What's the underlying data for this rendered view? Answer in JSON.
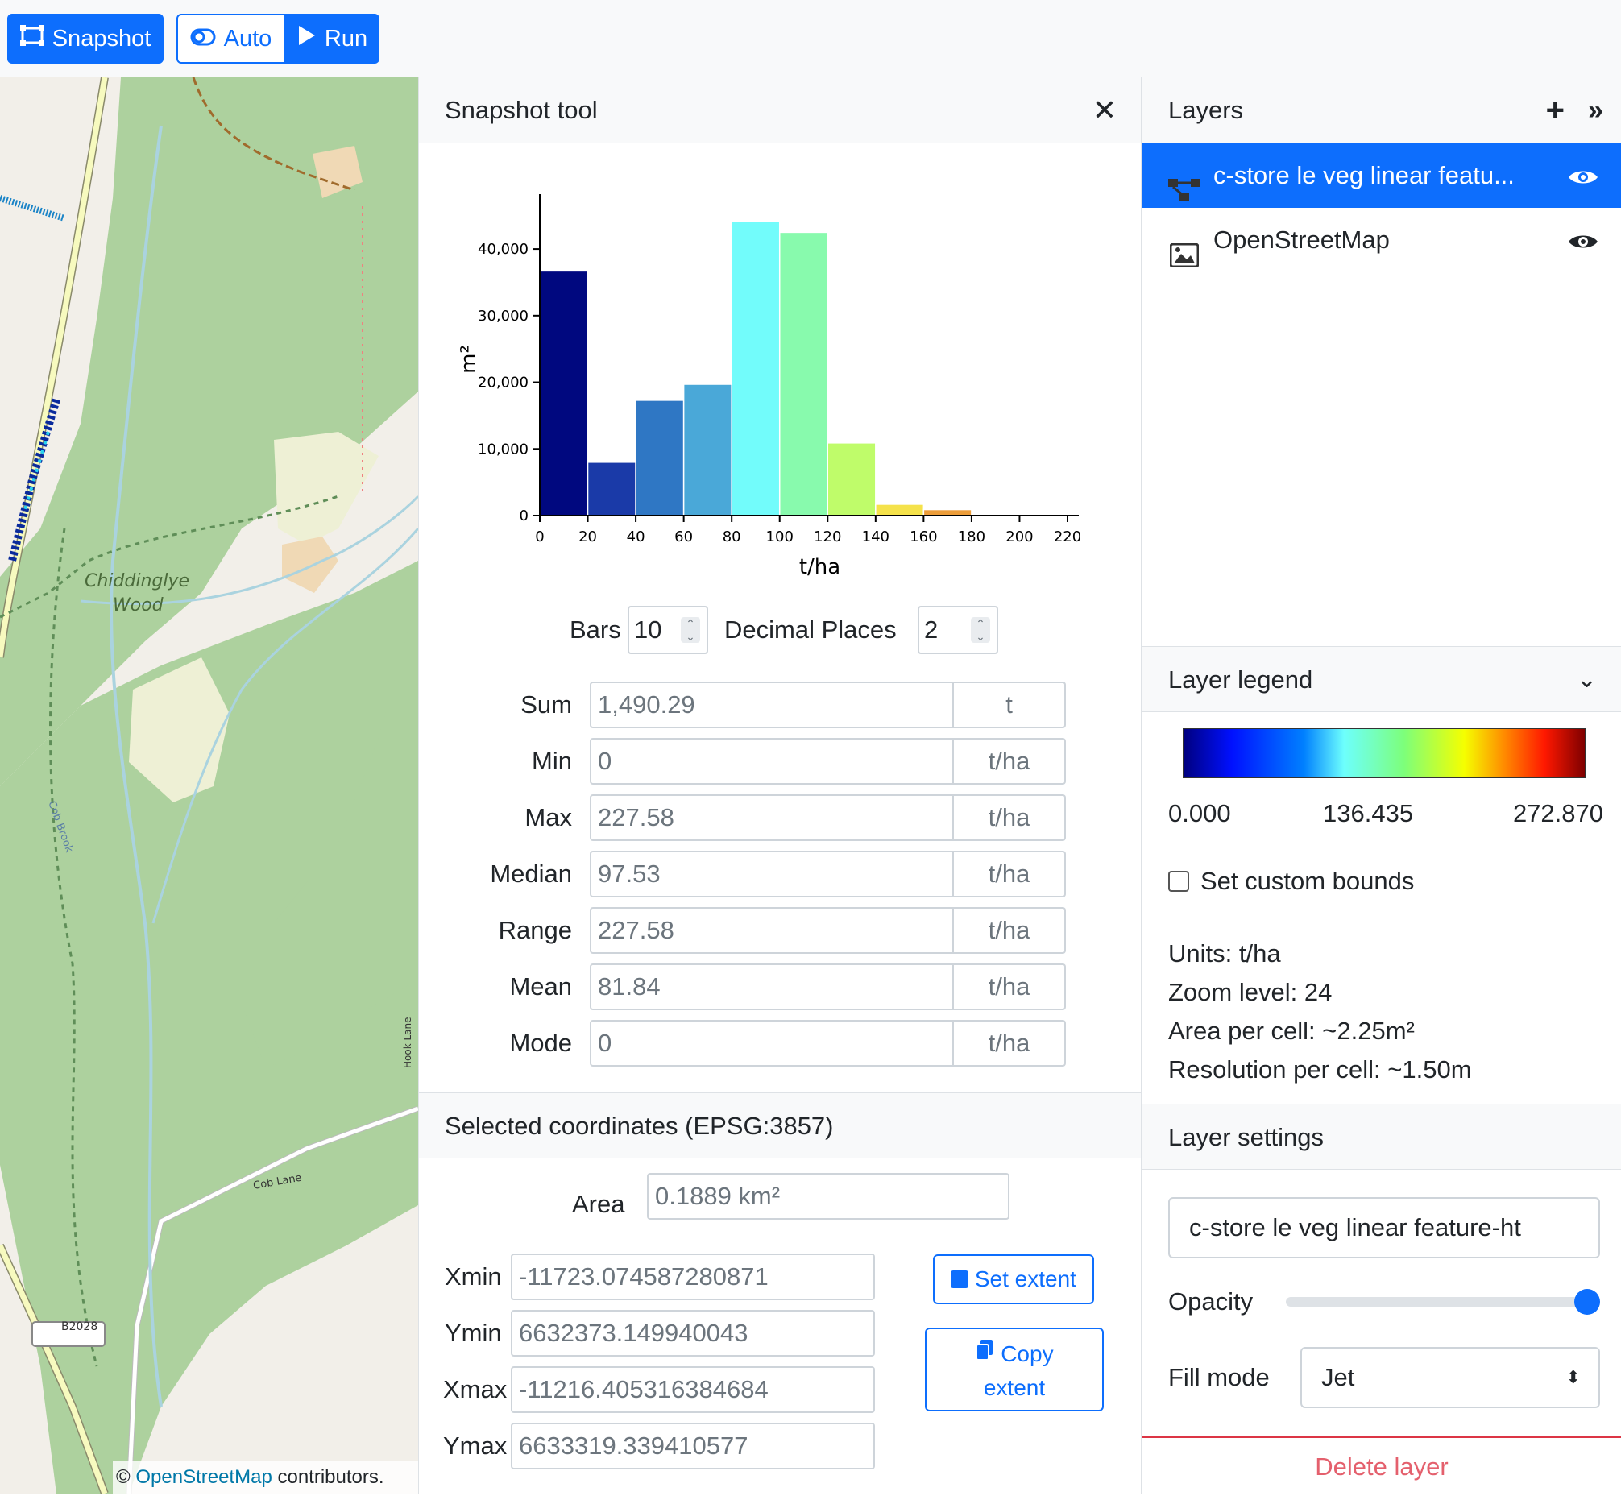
{
  "toolbar": {
    "snapshot_label": "Snapshot",
    "auto_label": "Auto",
    "run_label": "Run"
  },
  "map": {
    "place_label_1": "Chiddinglye",
    "place_label_2": "Wood",
    "road_labels": [
      "Cob Brook",
      "Cob Lane",
      "Hook Lane",
      "B2028",
      "Cob Lane"
    ],
    "attribution_prefix": "©",
    "attribution_link": "OpenStreetMap",
    "attribution_suffix": "contributors."
  },
  "snapshot": {
    "title": "Snapshot tool",
    "bars_label": "Bars",
    "bars_value": "10",
    "decimals_label": "Decimal Places",
    "decimals_value": "2",
    "stats": [
      {
        "label": "Sum",
        "value": "1,490.29",
        "unit": "t"
      },
      {
        "label": "Min",
        "value": "0",
        "unit": "t/ha"
      },
      {
        "label": "Max",
        "value": "227.58",
        "unit": "t/ha"
      },
      {
        "label": "Median",
        "value": "97.53",
        "unit": "t/ha"
      },
      {
        "label": "Range",
        "value": "227.58",
        "unit": "t/ha"
      },
      {
        "label": "Mean",
        "value": "81.84",
        "unit": "t/ha"
      },
      {
        "label": "Mode",
        "value": "0",
        "unit": "t/ha"
      }
    ],
    "coords_title": "Selected coordinates (EPSG:3857)",
    "area_label": "Area",
    "area_value": "0.1889 km²",
    "xmin_label": "Xmin",
    "xmin_value": "-11723.074587280871",
    "ymin_label": "Ymin",
    "ymin_value": "6632373.149940043",
    "xmax_label": "Xmax",
    "xmax_value": "-11216.405316384684",
    "ymax_label": "Ymax",
    "ymax_value": "6633319.339410577",
    "set_extent_label": "Set extent",
    "copy_extent_label_1": "Copy",
    "copy_extent_label_2": "extent"
  },
  "chart_data": {
    "type": "bar",
    "bins": [
      [
        0,
        20
      ],
      [
        20,
        40
      ],
      [
        40,
        60
      ],
      [
        60,
        80
      ],
      [
        80,
        100
      ],
      [
        100,
        120
      ],
      [
        120,
        140
      ],
      [
        140,
        160
      ],
      [
        160,
        180
      ],
      [
        180,
        200
      ]
    ],
    "values": [
      36700,
      8000,
      17300,
      19700,
      44100,
      42500,
      10900,
      1700,
      900,
      0
    ],
    "colors": [
      "#00087f",
      "#1a3aa8",
      "#2f77c4",
      "#4aa8d8",
      "#72fcfb",
      "#88faad",
      "#bffc6a",
      "#f5e24b",
      "#ec9d3a",
      "#ec9d3a"
    ],
    "xticks": [
      "0",
      "20",
      "40",
      "60",
      "80",
      "100",
      "120",
      "140",
      "160",
      "180",
      "200",
      "220"
    ],
    "yticks": [
      "0",
      "10,000",
      "20,000",
      "30,000",
      "40,000"
    ],
    "xlabel": "t/ha",
    "ylabel": "m²",
    "xlim": [
      0,
      227.58
    ],
    "ylim": [
      0,
      44100
    ]
  },
  "layers": {
    "title": "Layers",
    "items": [
      {
        "name": "c-store le veg linear featu...",
        "active": true
      },
      {
        "name": "OpenStreetMap",
        "active": false
      }
    ],
    "legend_title": "Layer legend",
    "legend_min": "0.000",
    "legend_mid": "136.435",
    "legend_max": "272.870",
    "custom_bounds_label": "Set custom bounds",
    "units_line": "Units: t/ha",
    "zoom_line": "Zoom level: 24",
    "area_line": "Area per cell: ~2.25m²",
    "resolution_line": "Resolution per cell: ~1.50m",
    "settings_title": "Layer settings",
    "layer_name_value": "c-store le veg linear feature-ht",
    "opacity_label": "Opacity",
    "opacity_value": 1.0,
    "fill_mode_label": "Fill mode",
    "fill_mode_value": "Jet",
    "delete_label": "Delete layer"
  }
}
